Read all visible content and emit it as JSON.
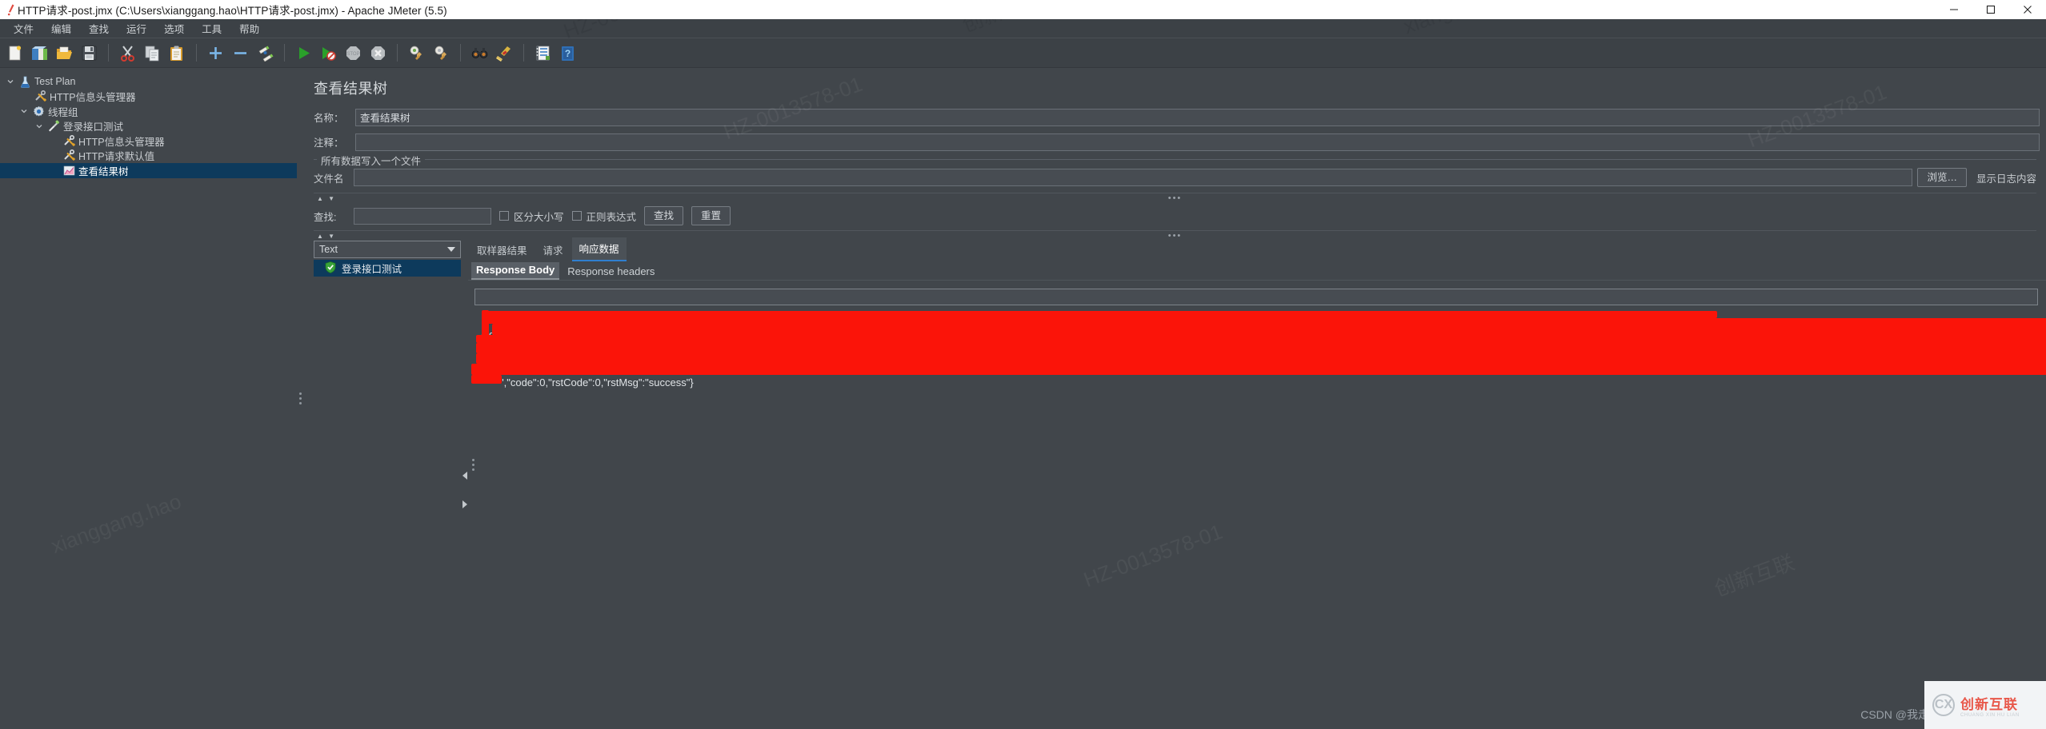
{
  "window": {
    "title": "HTTP请求-post.jmx (C:\\Users\\xianggang.hao\\HTTP请求-post.jmx) - Apache JMeter (5.5)",
    "app_icon": "jmeter-feather-icon",
    "minimize_label": "—",
    "maximize_label": "□",
    "close_label": "✕"
  },
  "menu": {
    "items": [
      {
        "label": "文件",
        "name": "menu-file"
      },
      {
        "label": "编辑",
        "name": "menu-edit"
      },
      {
        "label": "查找",
        "name": "menu-search"
      },
      {
        "label": "运行",
        "name": "menu-run"
      },
      {
        "label": "选项",
        "name": "menu-options"
      },
      {
        "label": "工具",
        "name": "menu-tools"
      },
      {
        "label": "帮助",
        "name": "menu-help"
      }
    ]
  },
  "toolbar": {
    "buttons": [
      {
        "name": "new-icon",
        "icon": "new-document"
      },
      {
        "name": "templates-icon",
        "icon": "templates"
      },
      {
        "name": "open-icon",
        "icon": "open-folder"
      },
      {
        "name": "save-icon",
        "icon": "save-floppy"
      },
      {
        "name": "cut-icon",
        "icon": "scissors"
      },
      {
        "name": "copy-icon",
        "icon": "copy-pages"
      },
      {
        "name": "paste-icon",
        "icon": "clipboard"
      },
      {
        "name": "expand-icon",
        "icon": "plus"
      },
      {
        "name": "collapse-icon",
        "icon": "minus"
      },
      {
        "name": "toggle-icon",
        "icon": "toggle-pencils"
      },
      {
        "name": "start-icon",
        "icon": "play-green"
      },
      {
        "name": "start-no-pause-icon",
        "icon": "play-no-pause"
      },
      {
        "name": "stop-icon",
        "icon": "stop-octagon"
      },
      {
        "name": "shutdown-icon",
        "icon": "shutdown-x"
      },
      {
        "name": "clear-icon",
        "icon": "gear-broom"
      },
      {
        "name": "clear-all-icon",
        "icon": "gear-broom-all"
      },
      {
        "name": "search-icon",
        "icon": "binoculars"
      },
      {
        "name": "reset-search-icon",
        "icon": "broom"
      },
      {
        "name": "function-helper-icon",
        "icon": "notebook"
      },
      {
        "name": "help-icon",
        "icon": "help-book"
      }
    ]
  },
  "tree": {
    "nodes": [
      {
        "label": "Test Plan",
        "icon": "flask-icon",
        "depth": 0,
        "toggle": "expanded",
        "selected": false
      },
      {
        "label": "HTTP信息头管理器",
        "icon": "wrench-screwdriver-icon",
        "depth": 1,
        "toggle": "none",
        "selected": false
      },
      {
        "label": "线程组",
        "icon": "gear-icon",
        "depth": 1,
        "toggle": "expanded",
        "selected": false
      },
      {
        "label": "登录接口测试",
        "icon": "pipette-icon",
        "depth": 2,
        "toggle": "expanded",
        "selected": false
      },
      {
        "label": "HTTP信息头管理器",
        "icon": "wrench-screwdriver-icon",
        "depth": 3,
        "toggle": "none",
        "selected": false
      },
      {
        "label": "HTTP请求默认值",
        "icon": "wrench-screwdriver-icon",
        "depth": 3,
        "toggle": "none",
        "selected": false
      },
      {
        "label": "查看结果树",
        "icon": "chart-icon",
        "depth": 3,
        "toggle": "none",
        "selected": true
      }
    ]
  },
  "panel": {
    "title": "查看结果树",
    "name_label": "名称：",
    "name_value": "查看结果树",
    "comment_label": "注释：",
    "comment_value": "",
    "group_legend": "所有数据写入一个文件",
    "filename_label": "文件名",
    "filename_value": "",
    "browse_button": "浏览…",
    "log_display_label": "显示日志内容",
    "splitter_up": "▲",
    "splitter_down": "▼",
    "splitter_dots": "•••"
  },
  "search": {
    "label": "查找:",
    "value": "",
    "case_sensitive_label": "区分大小写",
    "case_sensitive_checked": false,
    "regex_label": "正则表达式",
    "regex_checked": false,
    "find_button": "查找",
    "reset_button": "重置"
  },
  "results": {
    "renderer_selected": "Text",
    "renderer_name": "render-combo",
    "items": [
      {
        "label": "登录接口测试",
        "status": "success",
        "icon": "green-shield-check-icon",
        "selected": true
      }
    ]
  },
  "tabs": {
    "main": [
      {
        "label": "取样器结果",
        "active": false
      },
      {
        "label": "请求",
        "active": false
      },
      {
        "label": "响应数据",
        "active": true
      }
    ],
    "sub": [
      {
        "label": "Response Body",
        "active": true
      },
      {
        "label": "Response headers",
        "active": false
      }
    ]
  },
  "response": {
    "find_field_value": "",
    "visible_text_start": "{",
    "visible_text_fragment": "d",
    "visible_text_tail": "\",\"code\":0,\"rstCode\":0,\"rstMsg\":\"success\"}",
    "redaction_color": "#fb1409"
  },
  "watermarks": {
    "csdn": "CSDN @我走过",
    "badge_cn": "创新互联",
    "badge_en": "CHUANG XIN HU LIAN",
    "badge_logo": "CX",
    "tiles": [
      "HZ-0013578-01",
      "xianggang.hao",
      "创新互联"
    ]
  },
  "colors": {
    "window_bg": "#41464b",
    "titlebar_bg": "#ffffff",
    "selection": "#0d3a5c",
    "accent": "#2f7fd0",
    "redaction": "#fb1409"
  }
}
